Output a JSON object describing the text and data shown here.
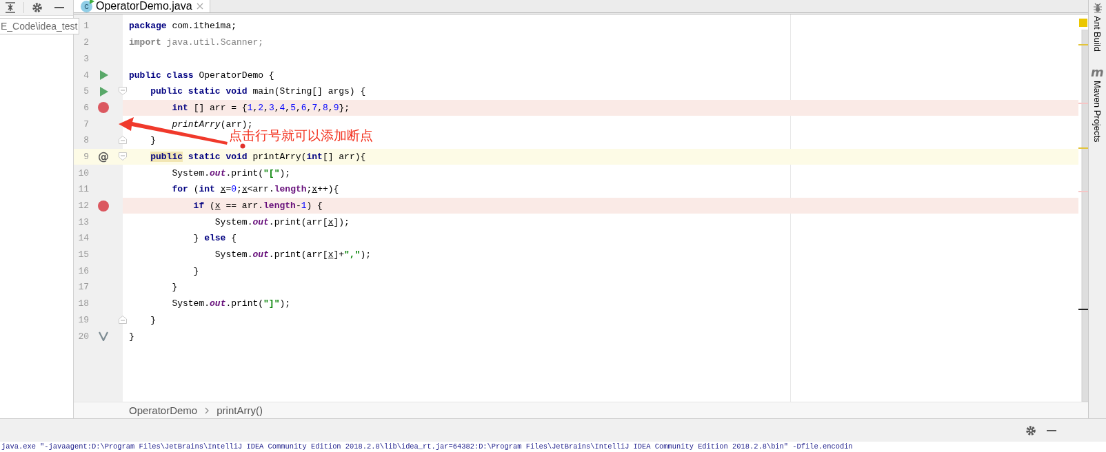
{
  "project_panel": {
    "path_tooltip": "E_Code\\idea_test"
  },
  "tabs": [
    {
      "label": "OperatorDemo.java",
      "icon_text": "c",
      "selected": true
    }
  ],
  "lines": [
    {
      "number": "1",
      "current": false,
      "segments": [
        {
          "kind": "kw",
          "text": "package"
        },
        {
          "kind": "plain",
          "text": " com.itheima;"
        }
      ]
    },
    {
      "number": "2",
      "current": false,
      "segments": [
        {
          "kind": "muted-kw",
          "text": "import"
        },
        {
          "kind": "muted",
          "text": " java.util.Scanner;"
        }
      ]
    },
    {
      "number": "3",
      "current": false
    },
    {
      "number": "4",
      "current": false,
      "gutter": {
        "kind": "run"
      },
      "segments": [
        {
          "kind": "kw",
          "text": "public class"
        },
        {
          "kind": "plain",
          "text": " OperatorDemo {"
        }
      ]
    },
    {
      "number": "5",
      "current": false,
      "fold": {
        "kind": "start"
      },
      "gutter": {
        "kind": "run"
      },
      "segments": [
        {
          "kind": "kw",
          "text": "    public static void"
        },
        {
          "kind": "plain",
          "text": " main(String[] args) {"
        }
      ]
    },
    {
      "number": "6",
      "current": false,
      "gutter": {
        "kind": "breakpoint"
      },
      "segments": [
        {
          "kind": "kw",
          "text": "        int"
        },
        {
          "kind": "plain",
          "text": " [] arr = {"
        },
        {
          "kind": "num",
          "text": "1"
        },
        {
          "kind": "plain",
          "text": ","
        },
        {
          "kind": "num",
          "text": "2"
        },
        {
          "kind": "plain",
          "text": ","
        },
        {
          "kind": "num",
          "text": "3"
        },
        {
          "kind": "plain",
          "text": ","
        },
        {
          "kind": "num",
          "text": "4"
        },
        {
          "kind": "plain",
          "text": ","
        },
        {
          "kind": "num",
          "text": "5"
        },
        {
          "kind": "plain",
          "text": ","
        },
        {
          "kind": "num",
          "text": "6"
        },
        {
          "kind": "plain",
          "text": ","
        },
        {
          "kind": "num",
          "text": "7"
        },
        {
          "kind": "plain",
          "text": ","
        },
        {
          "kind": "num",
          "text": "8"
        },
        {
          "kind": "plain",
          "text": ","
        },
        {
          "kind": "num",
          "text": "9"
        },
        {
          "kind": "plain",
          "text": "};"
        }
      ]
    },
    {
      "number": "7",
      "current": false,
      "segments": [
        {
          "kind": "call-static",
          "text": "        printArry"
        },
        {
          "kind": "plain",
          "text": "(arr);"
        }
      ]
    },
    {
      "number": "8",
      "current": false,
      "fold": {
        "kind": "end"
      },
      "segments": [
        {
          "kind": "plain",
          "text": "    }"
        }
      ]
    },
    {
      "number": "9",
      "current": true,
      "fold": {
        "kind": "start"
      },
      "gutter": {
        "kind": "override",
        "text": "@"
      },
      "segments": [
        {
          "kind": "kw-marked",
          "text": "    public"
        },
        {
          "kind": "kw",
          "text": " static void"
        },
        {
          "kind": "plain",
          "text": " printArry("
        },
        {
          "kind": "kw",
          "text": "int"
        },
        {
          "kind": "plain",
          "text": "[] arr){"
        }
      ]
    },
    {
      "number": "10",
      "current": false,
      "segments": [
        {
          "kind": "plain",
          "text": "        System."
        },
        {
          "kind": "field-static",
          "text": "out"
        },
        {
          "kind": "plain",
          "text": ".print("
        },
        {
          "kind": "str",
          "text": "\"[\""
        },
        {
          "kind": "plain",
          "text": ");"
        }
      ]
    },
    {
      "number": "11",
      "current": false,
      "segments": [
        {
          "kind": "kw",
          "text": "        for"
        },
        {
          "kind": "plain",
          "text": " ("
        },
        {
          "kind": "kw",
          "text": "int "
        },
        {
          "kind": "var",
          "text": "x"
        },
        {
          "kind": "plain",
          "text": "="
        },
        {
          "kind": "num",
          "text": "0"
        },
        {
          "kind": "plain",
          "text": ";"
        },
        {
          "kind": "var",
          "text": "x"
        },
        {
          "kind": "plain",
          "text": "<arr."
        },
        {
          "kind": "field",
          "text": "length"
        },
        {
          "kind": "plain",
          "text": ";"
        },
        {
          "kind": "var",
          "text": "x"
        },
        {
          "kind": "plain",
          "text": "++){"
        }
      ]
    },
    {
      "number": "12",
      "current": false,
      "gutter": {
        "kind": "breakpoint"
      },
      "segments": [
        {
          "kind": "kw",
          "text": "            if"
        },
        {
          "kind": "plain",
          "text": " ("
        },
        {
          "kind": "var",
          "text": "x"
        },
        {
          "kind": "plain",
          "text": " == arr."
        },
        {
          "kind": "field",
          "text": "length"
        },
        {
          "kind": "plain",
          "text": "-"
        },
        {
          "kind": "num",
          "text": "1"
        },
        {
          "kind": "plain",
          "text": ") {"
        }
      ]
    },
    {
      "number": "13",
      "current": false,
      "segments": [
        {
          "kind": "plain",
          "text": "                System."
        },
        {
          "kind": "field-static",
          "text": "out"
        },
        {
          "kind": "plain",
          "text": ".print(arr["
        },
        {
          "kind": "var",
          "text": "x"
        },
        {
          "kind": "plain",
          "text": "]);"
        }
      ]
    },
    {
      "number": "14",
      "current": false,
      "segments": [
        {
          "kind": "plain",
          "text": "            } "
        },
        {
          "kind": "kw",
          "text": "else"
        },
        {
          "kind": "plain",
          "text": " {"
        }
      ]
    },
    {
      "number": "15",
      "current": false,
      "segments": [
        {
          "kind": "plain",
          "text": "                System."
        },
        {
          "kind": "field-static",
          "text": "out"
        },
        {
          "kind": "plain",
          "text": ".print(arr["
        },
        {
          "kind": "var",
          "text": "x"
        },
        {
          "kind": "plain",
          "text": "]+"
        },
        {
          "kind": "str",
          "text": "\",\""
        },
        {
          "kind": "plain",
          "text": ");"
        }
      ]
    },
    {
      "number": "16",
      "current": false,
      "segments": [
        {
          "kind": "plain",
          "text": "            }"
        }
      ]
    },
    {
      "number": "17",
      "current": false,
      "segments": [
        {
          "kind": "plain",
          "text": "        }"
        }
      ]
    },
    {
      "number": "18",
      "current": false,
      "segments": [
        {
          "kind": "plain",
          "text": "        System."
        },
        {
          "kind": "field-static",
          "text": "out"
        },
        {
          "kind": "plain",
          "text": ".print("
        },
        {
          "kind": "str",
          "text": "\"]\""
        },
        {
          "kind": "plain",
          "text": ");"
        }
      ]
    },
    {
      "number": "19",
      "current": false,
      "fold": {
        "kind": "end"
      },
      "segments": [
        {
          "kind": "plain",
          "text": "    }"
        }
      ]
    },
    {
      "number": "20",
      "current": false,
      "gutter": {
        "kind": "check"
      },
      "segments": [
        {
          "kind": "plain",
          "text": "}"
        }
      ]
    }
  ],
  "annotation": {
    "text": "点击行号就可以添加断点"
  },
  "breadcrumbs": [
    "OperatorDemo",
    "printArry()"
  ],
  "side_tools": [
    {
      "kind": "ant",
      "label": "Ant Build"
    },
    {
      "kind": "maven",
      "glyph": "m",
      "label": "Maven Projects"
    }
  ],
  "console": {
    "text": "java.exe \"-javaagent:D:\\Program Files\\JetBrains\\IntelliJ IDEA Community Edition 2018.2.8\\lib\\idea_rt.jar=64382:D:\\Program Files\\JetBrains\\IntelliJ IDEA Community Edition 2018.2.8\\bin\" -Dfile.encodin"
  }
}
